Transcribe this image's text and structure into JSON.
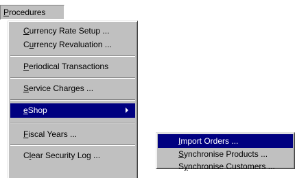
{
  "menubar": {
    "title_mnemonic": "P",
    "title_rest": "rocedures"
  },
  "menu": {
    "items": [
      {
        "pre": "",
        "mn": "C",
        "post": "urrency Rate Setup ..."
      },
      {
        "pre": "C",
        "mn": "u",
        "post": "rrency Revaluation ..."
      },
      {
        "pre": "",
        "mn": "P",
        "post": "eriodical Transactions"
      },
      {
        "pre": "",
        "mn": "S",
        "post": "ervice Charges ..."
      },
      {
        "pre": "",
        "mn": "e",
        "post": "Shop"
      },
      {
        "pre": "",
        "mn": "F",
        "post": "iscal Years ..."
      },
      {
        "pre": "C",
        "mn": "l",
        "post": "ear Security Log ..."
      }
    ]
  },
  "submenu": {
    "items": [
      {
        "pre": "",
        "mn": "I",
        "post": "mport Orders ..."
      },
      {
        "pre": "",
        "mn": "S",
        "post": "ynchronise Products ..."
      },
      {
        "pre": "S",
        "mn": "y",
        "post": "nchronise Customers ..."
      }
    ]
  },
  "colors": {
    "menu_face": "#c0c0c0",
    "highlight": "#000080",
    "highlight_text": "#ffffff"
  },
  "icons": {
    "submenu_arrow": "chevron-right-icon"
  }
}
